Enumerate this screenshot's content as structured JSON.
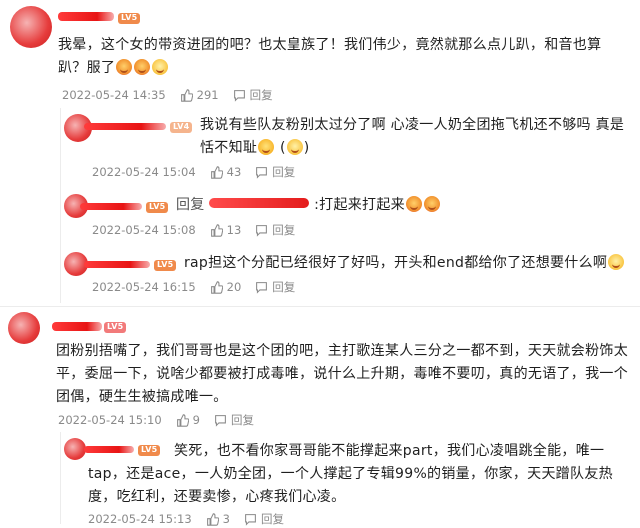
{
  "comments": [
    {
      "id": "c1",
      "badge": "LV5",
      "text": "我晕，这个女的带资进团的吧？也太皇族了！我们伟少，竟然就那么点儿趴，和音也算趴？服了",
      "time": "2022-05-24 14:35",
      "likes": "291",
      "reply_label": "回复",
      "replies": [
        {
          "id": "r1",
          "badge": "LV4",
          "text": "我说有些队友粉别太过分了啊 心凌一人奶全团拖飞机还不够吗 真是恬不知耻",
          "time": "2022-05-24 15:04",
          "likes": "43",
          "reply_label": "回复"
        },
        {
          "id": "r2",
          "badge": "LV5",
          "reply_prefix": "回复",
          "text": ":打起来打起来",
          "time": "2022-05-24 15:08",
          "likes": "13",
          "reply_label": "回复"
        },
        {
          "id": "r3",
          "badge": "LV5",
          "text": "rap担这个分配已经很好了好吗，开头和end都给你了还想要什么啊",
          "time": "2022-05-24 16:15",
          "likes": "20",
          "reply_label": "回复"
        }
      ]
    },
    {
      "id": "c2",
      "badge": "LV5",
      "text_lines": [
        "团粉别捂嘴了，我们哥哥也是这个团的吧，主打歌连某人三分之一都不到，天天就会粉饰太",
        "平，委屈一下，说啥少都要被打成毒唯，说什么上升期，毒唯不要叨，真的无语了，我一个",
        "团偶，硬生生被搞成唯一。"
      ],
      "time": "2022-05-24 15:10",
      "likes": "9",
      "reply_label": "回复",
      "replies": [
        {
          "id": "r4",
          "badge": "LV5",
          "text_lines": [
            "笑死，也不看你家哥哥能不能撑起来part，我们心凌唱跳全能，唯一",
            "tap，还是ace，一人奶全团，一个人撑起了专辑99%的销量，你家，天天蹭队友热",
            "度，吃红利，还要卖惨，心疼我们心凌。"
          ],
          "time": "2022-05-24 15:13",
          "likes": "3",
          "reply_label": "回复"
        }
      ]
    }
  ],
  "icons": {
    "like": "thumbs-up-icon",
    "reply": "comment-bubble-icon"
  },
  "colors": {
    "badge": "#f08a4b",
    "redaction": "#e81414",
    "meta": "#8a8a8a"
  }
}
